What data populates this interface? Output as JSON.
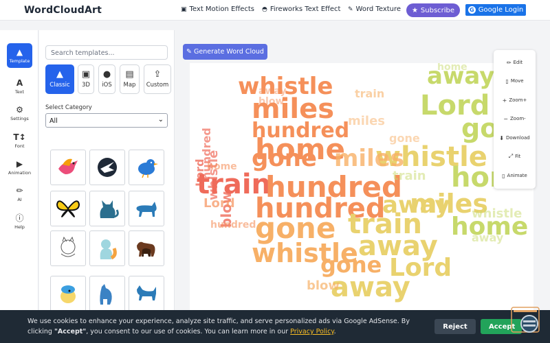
{
  "header": {
    "logo": "WordCloudArt",
    "nav": [
      {
        "label": "Text Motion Effects",
        "icon": "cube-icon"
      },
      {
        "label": "Fireworks Text Effect",
        "icon": "flame-icon"
      },
      {
        "label": "Word Texture",
        "icon": "brush-icon"
      }
    ],
    "subscribe_label": "Subscribe",
    "google_label": "Google Login"
  },
  "sidebar": {
    "items": [
      {
        "label": "Template",
        "icon": "shapes-icon",
        "active": true
      },
      {
        "label": "Text",
        "icon": "text-icon"
      },
      {
        "label": "Settings",
        "icon": "gear-icon"
      },
      {
        "label": "Font",
        "icon": "font-icon"
      },
      {
        "label": "Animation",
        "icon": "play-icon"
      },
      {
        "label": "AI",
        "icon": "pen-icon"
      },
      {
        "label": "Help",
        "icon": "help-icon"
      }
    ]
  },
  "panel": {
    "search_placeholder": "Search templates...",
    "types": [
      {
        "label": "Classic",
        "icon": "shapes-icon",
        "active": true
      },
      {
        "label": "3D",
        "icon": "cube-icon"
      },
      {
        "label": "iOS",
        "icon": "apple-icon"
      },
      {
        "label": "Map",
        "icon": "map-icon"
      },
      {
        "label": "Custom",
        "icon": "upload-icon"
      }
    ],
    "category_label": "Select Category",
    "category_value": "All",
    "thumbnails": [
      "bird-icon",
      "phoenix-icon",
      "twitter-bird-icon",
      "butterfly-icon",
      "cat-icon",
      "cat-walking-icon",
      "cat-sketch-icon",
      "cat-sitting-icon",
      "dogs-icon",
      "cartoon-bird-icon",
      "dog-icon",
      "dog-standing-icon"
    ]
  },
  "main": {
    "generate_label": "Generate Word Cloud"
  },
  "toolbar": {
    "tools": [
      {
        "label": "Edit",
        "icon": "edit-icon"
      },
      {
        "label": "Move",
        "icon": "move-icon"
      },
      {
        "label": "Zoom+",
        "icon": "zoom-in-icon"
      },
      {
        "label": "Zoom-",
        "icon": "zoom-out-icon"
      },
      {
        "label": "Download",
        "icon": "download-icon"
      },
      {
        "label": "Fit",
        "icon": "fit-icon"
      },
      {
        "label": "Animate",
        "icon": "animate-icon"
      }
    ]
  },
  "wordcloud": {
    "words": [
      "whistle",
      "miles",
      "Lord",
      "hundred",
      "home",
      "gone",
      "train",
      "blow",
      "away"
    ],
    "colors": [
      "#ef6b5a",
      "#f5905a",
      "#f7b067",
      "#e9d26f",
      "#c7d96b",
      "#a6d276"
    ]
  },
  "cookie": {
    "text_before": "We use cookies to enhance your experience, analyze site traffic, and serve personalized ads via Google AdSense. By clicking ",
    "accept_word": "\"Accept\"",
    "text_middle": ", you consent to our use of cookies. You can learn more in our ",
    "policy_link": "Privacy Policy",
    "text_after": ".",
    "reject_label": "Reject",
    "accept_label": "Accept"
  }
}
